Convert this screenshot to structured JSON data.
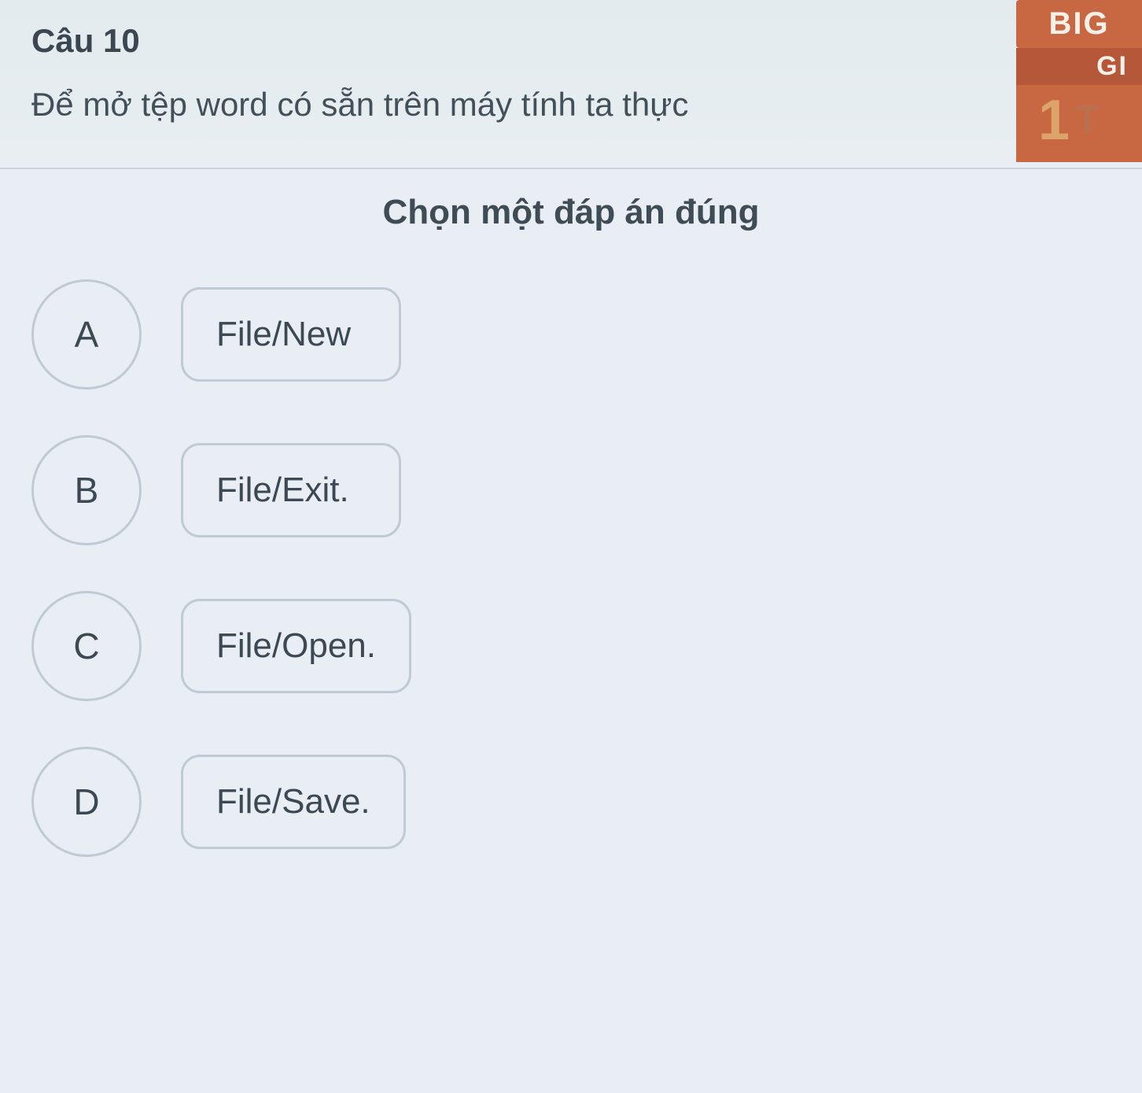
{
  "question": {
    "number": "Câu 10",
    "text": "Để mở tệp word có sẵn trên máy tính ta thực",
    "instruction": "Chọn một đáp án đúng"
  },
  "options": [
    {
      "letter": "A",
      "text": "File/New"
    },
    {
      "letter": "B",
      "text": "File/Exit."
    },
    {
      "letter": "C",
      "text": "File/Open."
    },
    {
      "letter": "D",
      "text": "File/Save."
    }
  ],
  "badge": {
    "line1": "BIG",
    "line2": "GI",
    "number": "1",
    "suffix": "T"
  }
}
